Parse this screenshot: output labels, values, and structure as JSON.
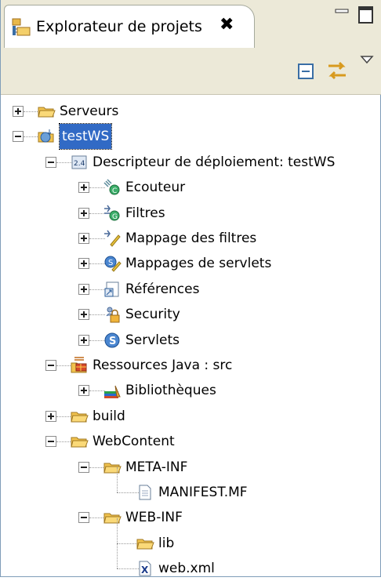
{
  "view": {
    "tab_title": "Explorateur de projets",
    "close_glyph": "✖",
    "minimize_glyph": "▭",
    "maximize_glyph": "□"
  },
  "tree": [
    {
      "label": "Serveurs",
      "icon": "folder-icon",
      "state": "collapsed"
    },
    {
      "label": "testWS",
      "icon": "web-project-icon",
      "state": "expanded",
      "selected": true
    },
    {
      "label": "Descripteur de déploiement: testWS",
      "icon": "deployment-descriptor-icon",
      "state": "expanded"
    },
    {
      "label": "Ecouteur",
      "icon": "listener-icon",
      "state": "collapsed"
    },
    {
      "label": "Filtres",
      "icon": "filter-icon",
      "state": "collapsed"
    },
    {
      "label": "Mappage des filtres",
      "icon": "filter-mapping-icon",
      "state": "collapsed"
    },
    {
      "label": "Mappages de servlets",
      "icon": "servlet-mapping-icon",
      "state": "collapsed"
    },
    {
      "label": "Références",
      "icon": "reference-icon",
      "state": "collapsed"
    },
    {
      "label": "Security",
      "icon": "security-icon",
      "state": "collapsed"
    },
    {
      "label": "Servlets",
      "icon": "servlet-icon",
      "state": "collapsed"
    },
    {
      "label": "Ressources Java : src",
      "icon": "java-resources-icon",
      "state": "expanded"
    },
    {
      "label": "Bibliothèques",
      "icon": "libraries-icon",
      "state": "collapsed"
    },
    {
      "label": "build",
      "icon": "folder-icon",
      "state": "collapsed"
    },
    {
      "label": "WebContent",
      "icon": "folder-icon",
      "state": "expanded"
    },
    {
      "label": "META-INF",
      "icon": "folder-icon",
      "state": "expanded"
    },
    {
      "label": "MANIFEST.MF",
      "icon": "file-icon",
      "state": "leaf"
    },
    {
      "label": "WEB-INF",
      "icon": "folder-icon",
      "state": "expanded"
    },
    {
      "label": "lib",
      "icon": "folder-icon",
      "state": "leaf"
    },
    {
      "label": "web.xml",
      "icon": "xml-file-icon",
      "state": "leaf"
    }
  ]
}
